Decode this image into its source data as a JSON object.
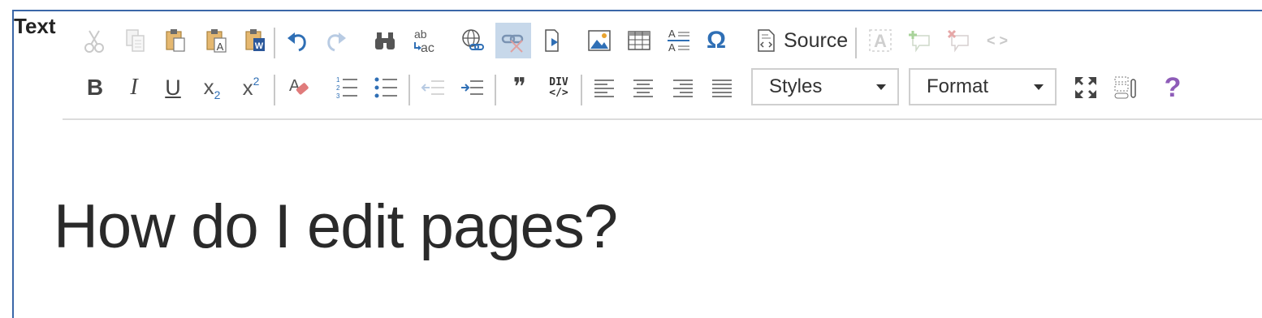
{
  "field_label": "Text",
  "colors": {
    "frame_border": "#3b67a8",
    "icon_blue": "#2f6fb5",
    "icon_disabled": "#c9c9c9",
    "active_bg": "#c7d8ea",
    "help_purple": "#8e5cb8"
  },
  "toolbar_row1": [
    {
      "name": "cut-icon",
      "state": "disabled"
    },
    {
      "name": "copy-icon",
      "state": "disabled"
    },
    {
      "name": "paste-icon"
    },
    {
      "name": "paste-as-text-icon",
      "glyph": "A"
    },
    {
      "name": "paste-from-word-icon",
      "glyph": "W"
    },
    {
      "name": "undo-icon"
    },
    {
      "name": "redo-icon",
      "state": "disabled"
    },
    {
      "name": "find-icon"
    },
    {
      "name": "replace-icon",
      "glyph_top": "ab",
      "glyph_bottom": "ac"
    },
    {
      "name": "link-icon"
    },
    {
      "name": "unlink-icon",
      "state": "active"
    },
    {
      "name": "anchor-icon"
    },
    {
      "name": "image-icon"
    },
    {
      "name": "table-icon"
    },
    {
      "name": "horizontal-rule-icon",
      "glyph": "A"
    },
    {
      "name": "special-char-icon",
      "glyph": "Ω"
    },
    {
      "name": "source-icon"
    },
    {
      "name": "spell-check-icon",
      "state": "disabled",
      "glyph": "A"
    },
    {
      "name": "add-comment-icon",
      "state": "disabled"
    },
    {
      "name": "remove-comment-icon",
      "state": "disabled"
    },
    {
      "name": "code-snippet-icon",
      "state": "disabled",
      "glyph": "< >"
    }
  ],
  "toolbar": {
    "source_label": "Source",
    "bold_glyph": "B",
    "italic_glyph": "I",
    "underline_glyph": "U",
    "subscript_glyph": "x",
    "subscript_mark": "2",
    "superscript_glyph": "x",
    "superscript_mark": "2",
    "blockquote_glyph": "❞",
    "div_glyph": "DIV",
    "help_glyph": "?",
    "list_numbers": [
      "1",
      "2",
      "3"
    ],
    "replace_top": "ab",
    "replace_bottom": "ac",
    "paste_text_glyph": "A",
    "paste_word_glyph": "W",
    "hr_glyph_top": "A",
    "hr_glyph_bottom": "A",
    "special_char_glyph": "Ω",
    "spell_glyph": "A",
    "code_glyph": "< >"
  },
  "combos": {
    "styles": {
      "label": "Styles"
    },
    "format": {
      "label": "Format"
    }
  },
  "editor": {
    "heading": "How do I edit pages?"
  }
}
